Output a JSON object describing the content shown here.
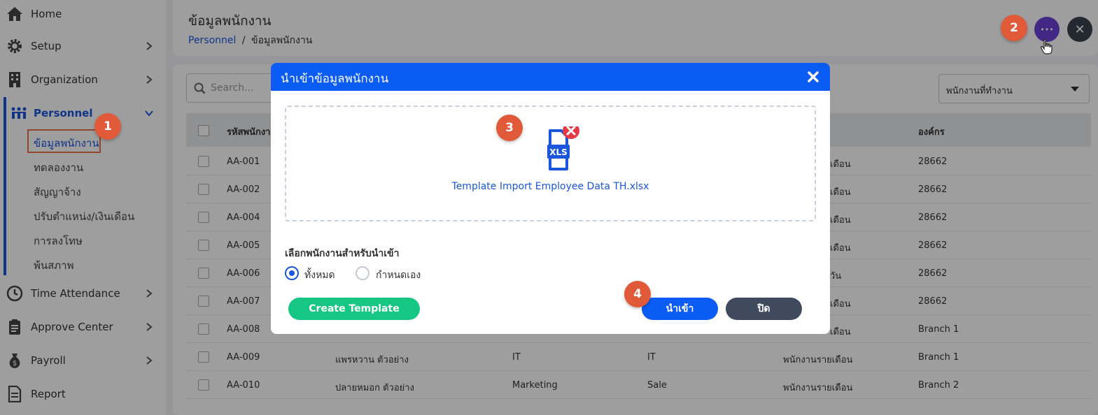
{
  "sidebar": {
    "items": [
      {
        "label": "Home",
        "icon": "home-icon"
      },
      {
        "label": "Setup",
        "icon": "gear-icon"
      },
      {
        "label": "Organization",
        "icon": "building-icon"
      },
      {
        "label": "Personnel",
        "icon": "people-icon"
      },
      {
        "label": "Time Attendance",
        "icon": "clock-icon"
      },
      {
        "label": "Approve Center",
        "icon": "clipboard-icon"
      },
      {
        "label": "Payroll",
        "icon": "money-bag-icon"
      },
      {
        "label": "Report",
        "icon": "document-icon"
      }
    ],
    "personnel_sub": [
      "ข้อมูลพนักงาน",
      "ทดลองงาน",
      "สัญญาจ้าง",
      "ปรับตำแหน่ง/เงินเดือน",
      "การลงโทษ",
      "พ้นสภาพ"
    ]
  },
  "header": {
    "title": "ข้อมูลพนักงาน",
    "breadcrumb_link": "Personnel",
    "breadcrumb_sep": "/",
    "breadcrumb_current": "ข้อมูลพนักงาน"
  },
  "toolbar": {
    "more_label": "•••",
    "close_label": "✕"
  },
  "filters": {
    "search_placeholder": "Search...",
    "status_select": "พนักงานที่ทำงาน"
  },
  "table": {
    "headers": [
      "รหัสพนักงาน",
      "องค์กร"
    ],
    "rows": [
      {
        "id": "AA-001",
        "name": "",
        "c3": "",
        "c4": "",
        "type": "เดือน",
        "org": "28662"
      },
      {
        "id": "AA-002",
        "name": "",
        "c3": "",
        "c4": "",
        "type": "เดือน",
        "org": "28662"
      },
      {
        "id": "AA-004",
        "name": "",
        "c3": "",
        "c4": "",
        "type": "เดือน",
        "org": "28662"
      },
      {
        "id": "AA-005",
        "name": "",
        "c3": "",
        "c4": "",
        "type": "เดือน",
        "org": "28662"
      },
      {
        "id": "AA-006",
        "name": "",
        "c3": "",
        "c4": "",
        "type": "วัน",
        "org": "28662"
      },
      {
        "id": "AA-007",
        "name": "",
        "c3": "",
        "c4": "",
        "type": "เดือน",
        "org": "28662"
      },
      {
        "id": "AA-008",
        "name": "",
        "c3": "",
        "c4": "",
        "type": "เดือน",
        "org": "Branch 1"
      },
      {
        "id": "AA-009",
        "name": "แพรหวาน ตัวอย่าง",
        "c3": "IT",
        "c4": "IT",
        "type": "พนักงานรายเดือน",
        "org": "Branch 1"
      },
      {
        "id": "AA-010",
        "name": "ปลายหมอก ตัวอย่าง",
        "c3": "Marketing",
        "c4": "Sale",
        "type": "พนักงานรายเดือน",
        "org": "Branch 2"
      }
    ]
  },
  "modal": {
    "title": "นำเข้าข้อมูลพนักงาน",
    "file_name": "Template Import Employee Data TH.xlsx",
    "file_type": "XLS",
    "select_label": "เลือกพนักงานสำหรับนำเข้า",
    "radio_all": "ทั้งหมด",
    "radio_custom": "กำหนดเอง",
    "create_template": "Create Template",
    "import": "นำเข้า",
    "close": "ปิด"
  },
  "badges": [
    "1",
    "2",
    "3",
    "4"
  ],
  "colors": {
    "primary": "#0a5cf5",
    "green": "#16c784",
    "dark_button": "#3f4a5e",
    "badge": "#e05a3a",
    "purple": "#6b3fd6"
  }
}
